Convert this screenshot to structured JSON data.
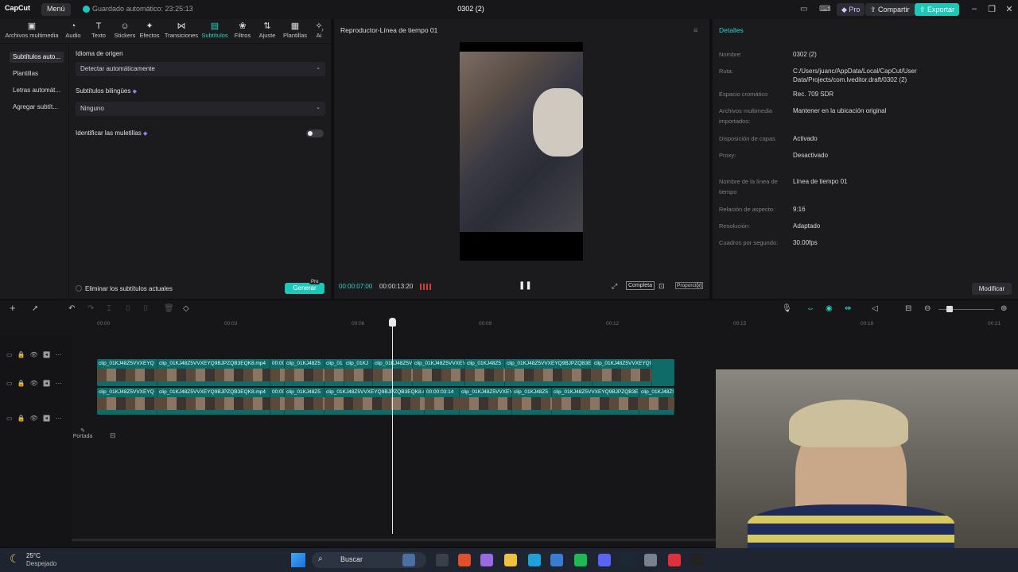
{
  "app": {
    "logo": "CapCut",
    "menu_label": "Menú",
    "autosave_status": "Guardado automático: 23:25:13",
    "project_title": "0302 (2)",
    "pro_label": "Pro",
    "share_label": "Compartir",
    "export_label": "Exportar"
  },
  "tool_tabs": [
    {
      "label": "Archivos multimedia",
      "icon": "media-icon"
    },
    {
      "label": "Audio",
      "icon": "audio-icon"
    },
    {
      "label": "Texto",
      "icon": "text-icon"
    },
    {
      "label": "Stickers",
      "icon": "sticker-icon"
    },
    {
      "label": "Efectos",
      "icon": "effects-icon"
    },
    {
      "label": "Transiciones",
      "icon": "transition-icon"
    },
    {
      "label": "Subtítulos",
      "icon": "captions-icon",
      "active": true
    },
    {
      "label": "Filtros",
      "icon": "filter-icon"
    },
    {
      "label": "Ajuste",
      "icon": "adjust-icon"
    },
    {
      "label": "Plantillas",
      "icon": "template-icon"
    },
    {
      "label": "Ai",
      "icon": "ai-icon"
    }
  ],
  "subnav": [
    {
      "label": "Subtítulos auto...",
      "active": true
    },
    {
      "label": "Plantillas"
    },
    {
      "label": "Letras automát..."
    },
    {
      "label": "Agregar subtít..."
    }
  ],
  "captions": {
    "source_language_label": "Idioma de origen",
    "source_language_value": "Detectar automáticamente",
    "bilingual_label": "Subtítulos bilingües",
    "bilingual_value": "Ninguno",
    "filler_label": "Identificar las muletillas",
    "filler_enabled": false,
    "remove_current_label": "Eliminar los subtítulos actuales",
    "generate_label": "Generar",
    "generate_badge": "Pro"
  },
  "player": {
    "title": "Reproductor-Línea de tiempo 01",
    "current_time": "00:00:07:00",
    "total_time": "00:00:13:20",
    "fit_label": "Completa",
    "ratio_label": "Proporción"
  },
  "details": {
    "title": "Detalles",
    "rows": [
      {
        "label": "Nombre:",
        "value": "0302 (2)"
      },
      {
        "label": "Ruta:",
        "value": "C:/Users/juanc/AppData/Local/CapCut/User Data/Projects/com.lveditor.draft/0302 (2)"
      },
      {
        "label": "Espacio cromático",
        "value": "Rec. 709 SDR"
      },
      {
        "label": "Archivos multimedia importados:",
        "value": "Mantener en la ubicación original"
      },
      {
        "label": "Disposición de capas",
        "value": "Activado"
      },
      {
        "label": "Proxy:",
        "value": "Desactivado"
      },
      {
        "label": "Nombre de la línea de tiempo",
        "value": "Línea de tiempo 01"
      },
      {
        "label": "Relación de aspecto:",
        "value": "9:16"
      },
      {
        "label": "Resolución:",
        "value": "Adaptado"
      },
      {
        "label": "Cuadros por segundo:",
        "value": "30.00fps"
      }
    ],
    "modify_label": "Modificar"
  },
  "timeline": {
    "ruler_ticks": [
      "00:00",
      "00:03",
      "00:06",
      "00:09",
      "00:12",
      "00:15",
      "00:18",
      "00:21"
    ],
    "track1_clips": [
      "clip_01KJ48Z5VVXEYQ",
      "clip_01KJ48Z5VVXEYQ9BJPZQB3EQK8.mp4",
      "00:00",
      "clip_01KJ48Z5",
      "clip_01",
      "clip_01KJ",
      "clip_01KJ48Z5VVXEYQ9",
      "clip_01KJ48Z5VVXEY",
      "clip_01KJ48Z5",
      "clip_01KJ48Z5VVXEYQ9BJPZQB3E",
      "clip_01KJ48Z5VVXEYQ9"
    ],
    "track2_clips": [
      "clip_01KJ48Z5VVXEYQ",
      "clip_01KJ48Z5VVXEYQ9BJPZQB3EQK8.mp4",
      "00:00",
      "clip_01KJ48Z5",
      "clip_01KJ48Z5VVXEYQ9BJPZQB3EQK8.mp4",
      "00:00:03:14",
      "clip_01KJ48Z5VVXEY",
      "clip_01KJ48Z5",
      "clip_01KJ48Z5VVXEYQ9BJPZQB3E",
      "clip_01KJ48Z5VVXEYQ9"
    ],
    "cover_label": "Portada"
  },
  "taskbar": {
    "weather_temp": "25°C",
    "weather_desc": "Despejado",
    "search_placeholder": "Buscar"
  },
  "colors": {
    "accent": "#1ec8b8",
    "clip": "#0e6b68"
  }
}
